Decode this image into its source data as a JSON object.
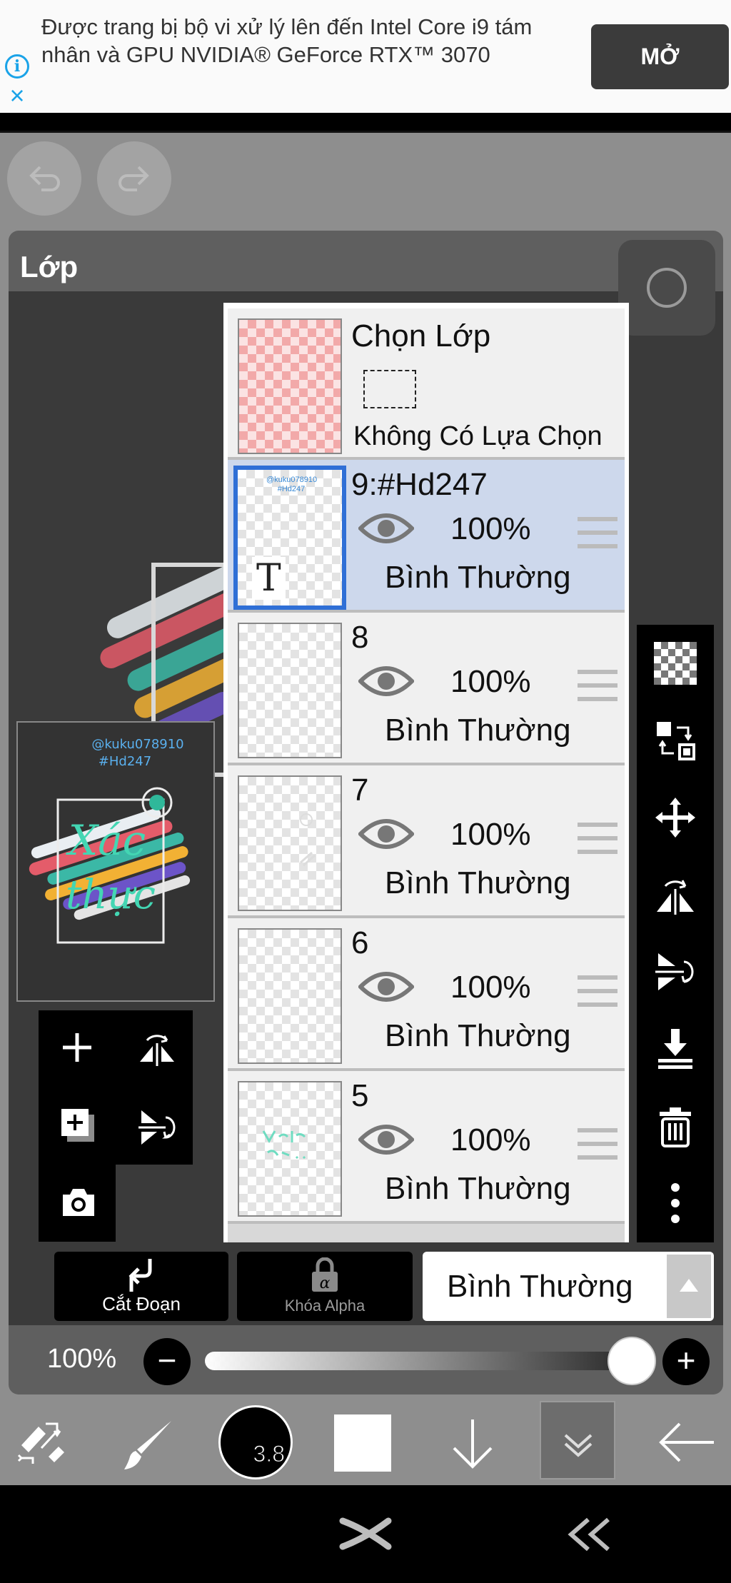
{
  "ad": {
    "text": "Được trang bị bộ vi xử lý lên đến Intel Core i9 tám nhân và GPU NVIDIA® GeForce RTX™ 3070",
    "button": "MỞ",
    "info_icon": "i",
    "close_icon": "×"
  },
  "panel": {
    "title": "Lớp"
  },
  "preview": {
    "handle1": "@kuku078910",
    "handle2": "#Hd247",
    "word1": "Xác",
    "word2": "thực"
  },
  "selection_layer": {
    "title": "Chọn Lớp",
    "status": "Không Có Lựa Chọn"
  },
  "layers": [
    {
      "name": "9:#Hd247",
      "opacity": "100%",
      "blend": "Bình Thường",
      "thumb_text": "T",
      "selected": true
    },
    {
      "name": "8",
      "opacity": "100%",
      "blend": "Bình Thường"
    },
    {
      "name": "7",
      "opacity": "100%",
      "blend": "Bình Thường"
    },
    {
      "name": "6",
      "opacity": "100%",
      "blend": "Bình Thường"
    },
    {
      "name": "5",
      "opacity": "100%",
      "blend": "Bình Thường"
    }
  ],
  "bottom_controls": {
    "clip_label": "Cắt Đoạn",
    "alpha_lock_label": "Khóa Alpha",
    "blend_mode": "Bình Thường"
  },
  "opacity": {
    "label": "100%",
    "value": 1.0,
    "minus": "−",
    "plus": "+"
  },
  "toolbar": {
    "brush_size": "3.8",
    "color": "#ffffff"
  },
  "colors": {
    "selected_layer_bg": "#cdd8ec",
    "selected_border": "#2f6fd6",
    "ad_accent": "#1aa3e8"
  }
}
